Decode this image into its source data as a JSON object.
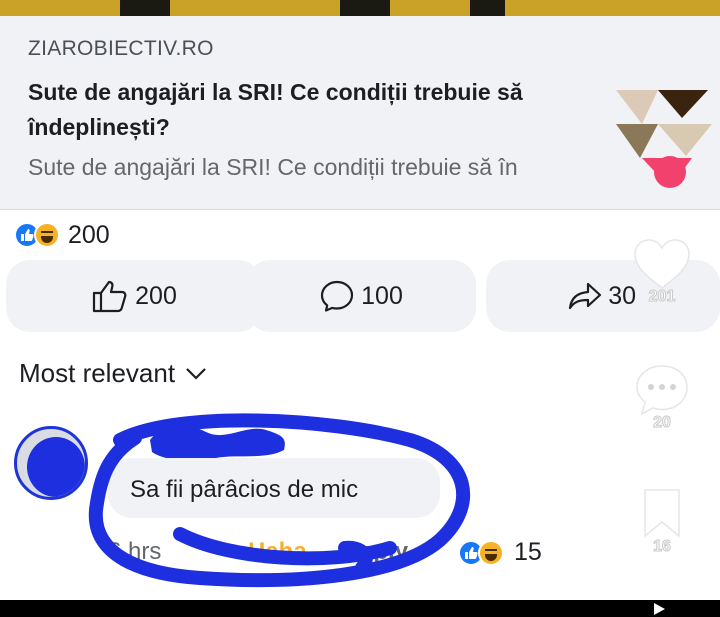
{
  "link_preview": {
    "domain": "ZIAROBIECTIV.RO",
    "headline": "Sute de angajări la SRI! Ce condiții trebuie să îndeplinești?",
    "snippet": "Sute de angajări la SRI! Ce condiții trebuie să în"
  },
  "reactions": {
    "icons": [
      "like-icon",
      "haha-icon"
    ],
    "count": "200"
  },
  "actions": {
    "like": {
      "label": "200",
      "icon": "thumbs-up-icon"
    },
    "comment": {
      "label": "100",
      "icon": "comment-icon"
    },
    "share": {
      "label": "30",
      "icon": "share-arrow-icon"
    }
  },
  "side_overlay": {
    "heart_count": "201",
    "comment_count": "20",
    "bookmark_count": "16"
  },
  "comments_sort": {
    "label": "Most relevant",
    "icon": "chevron-down-icon"
  },
  "comment": {
    "text": "Sa fii pârâcios de mic",
    "time": "6 hrs",
    "reaction_label": "Haha",
    "reply_label": "Reply",
    "reaction_count": "15"
  },
  "colors": {
    "brand_blue": "#1877f2",
    "haha_yellow": "#f7b125",
    "scribble_blue": "#1e2fe0",
    "card_gray": "#f0f2f5"
  }
}
